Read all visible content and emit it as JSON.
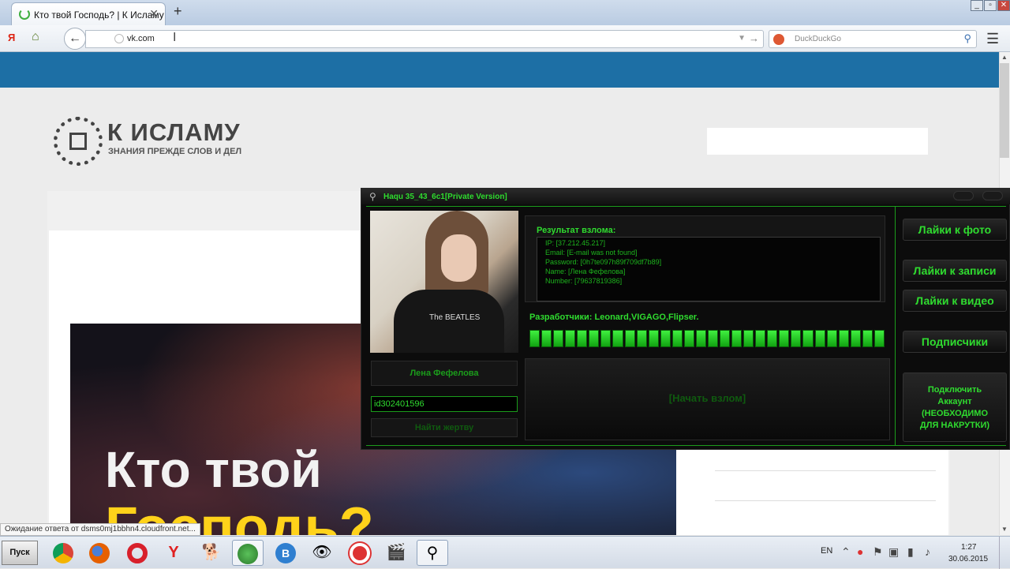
{
  "browser": {
    "tab_title": "Кто твой Господь? | К Исламу",
    "url": "vk.com",
    "search_placeholder": "DuckDuckGo",
    "status_text": "Ожидание ответа от dsms0mj1bbhn4.cloudfront.net..."
  },
  "site": {
    "logo_title": "К ИСЛАМУ",
    "logo_subtitle": "ЗНАНИЯ ПРЕЖДЕ СЛОВ И ДЕЛ",
    "banner_line1": "Кто твой",
    "banner_line2": "Господь?"
  },
  "hack_tool": {
    "title": "Haqu 35_43_6c1[Private Version]",
    "result_title": "Результат взлома:",
    "result_lines": [
      "IP: [37.212.45.217]",
      "Email: [E-mail was not found]",
      "Password: [0h7te097h89f709df7b89]",
      "Name: [Лена Фефелова]",
      "Number: [79637819386]"
    ],
    "developers": "Разработчики: Leonard,VIGAGO,Flipser.",
    "progress": 1.0,
    "profile_name": "Лена Фефелова",
    "profile_id": "id302401596",
    "find_button": "Найти жертву",
    "start_button": "[Начать взлом]",
    "side_buttons": [
      "Лайки к фото",
      "Лайки к записи",
      "Лайки к видео",
      "Подписчики"
    ],
    "connect_button": [
      "Подключить",
      "Аккаунт",
      "(НЕОБХОДИМО",
      "ДЛЯ НАКРУТКИ)"
    ],
    "avatar_shirt_text": "The BEATLES",
    "accent_color": "#2fdc2f"
  },
  "taskbar": {
    "start_label": "Пуск",
    "language": "EN",
    "time": "1:27",
    "date": "30.06.2015"
  }
}
